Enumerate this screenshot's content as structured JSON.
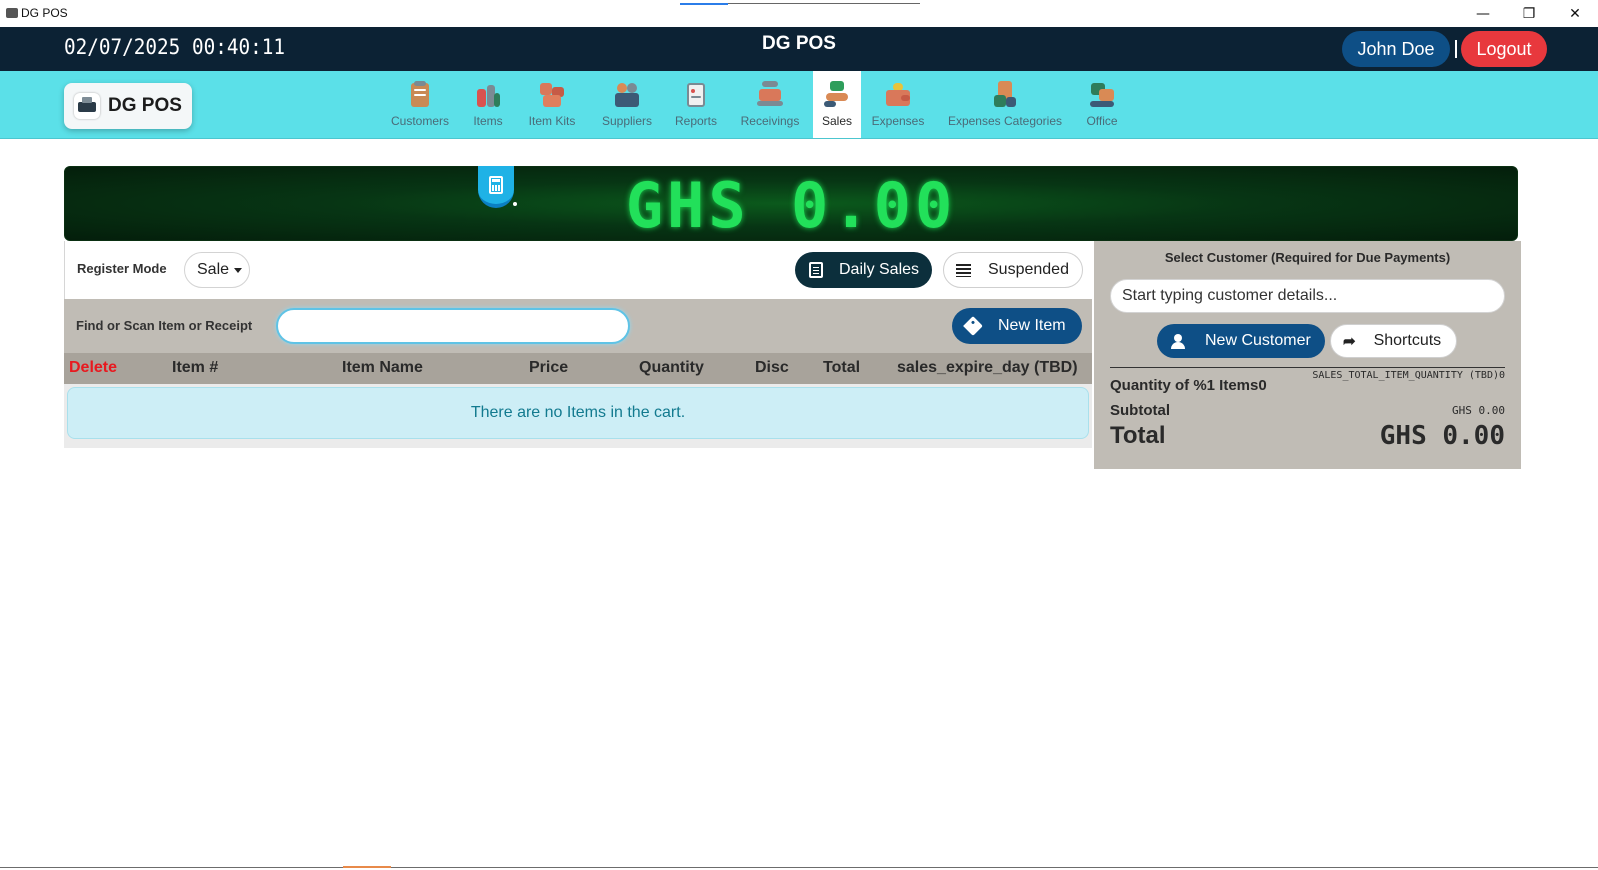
{
  "window": {
    "title": "DG POS",
    "minimize_glyph": "—",
    "maximize_glyph": "❐",
    "close_glyph": "✕"
  },
  "header": {
    "datetime": "02/07/2025 00:40:11",
    "app_title": "DG POS",
    "user_name": "John Doe",
    "separator": "|",
    "logout_label": "Logout"
  },
  "nav": {
    "logo_text": "DG POS",
    "items": [
      {
        "label": "Customers",
        "icon": "customers-icon"
      },
      {
        "label": "Items",
        "icon": "items-icon"
      },
      {
        "label": "Item Kits",
        "icon": "item-kits-icon"
      },
      {
        "label": "Suppliers",
        "icon": "suppliers-icon"
      },
      {
        "label": "Reports",
        "icon": "reports-icon"
      },
      {
        "label": "Receivings",
        "icon": "receivings-icon"
      },
      {
        "label": "Sales",
        "icon": "sales-icon",
        "active": true
      },
      {
        "label": "Expenses",
        "icon": "expenses-icon"
      },
      {
        "label": "Expenses Categories",
        "icon": "expenses-categories-icon"
      },
      {
        "label": "Office",
        "icon": "office-icon"
      }
    ]
  },
  "display": {
    "amount": "GHS 0.00",
    "calculator_icon": "calculator-icon",
    "color": "#22e05a"
  },
  "register": {
    "mode_label": "Register Mode",
    "mode_value": "Sale",
    "daily_sales_label": "Daily Sales",
    "suspended_label": "Suspended",
    "scan_label": "Find or Scan Item or Receipt",
    "scan_value": "",
    "new_item_label": "New Item",
    "columns": [
      "Delete",
      "Item #",
      "Item Name",
      "Price",
      "Quantity",
      "Disc",
      "Total",
      "sales_expire_day (TBD)"
    ],
    "empty_message": "There are no Items in the cart."
  },
  "customer": {
    "title": "Select Customer (Required for Due Payments)",
    "search_placeholder": "Start typing customer details...",
    "new_customer_label": "New Customer",
    "shortcuts_label": "Shortcuts"
  },
  "summary": {
    "qty_label": "Quantity of %1 Items0",
    "qty_value": "SALES_TOTAL_ITEM_QUANTITY (TBD)0",
    "subtotal_label": "Subtotal",
    "subtotal_value": "GHS 0.00",
    "total_label": "Total",
    "total_value": "GHS 0.00"
  },
  "colors": {
    "header_bg": "#0c2234",
    "nav_bg": "#5be0e8",
    "primary": "#0e4f86",
    "logout": "#e8383d",
    "delete": "#e8191f"
  }
}
